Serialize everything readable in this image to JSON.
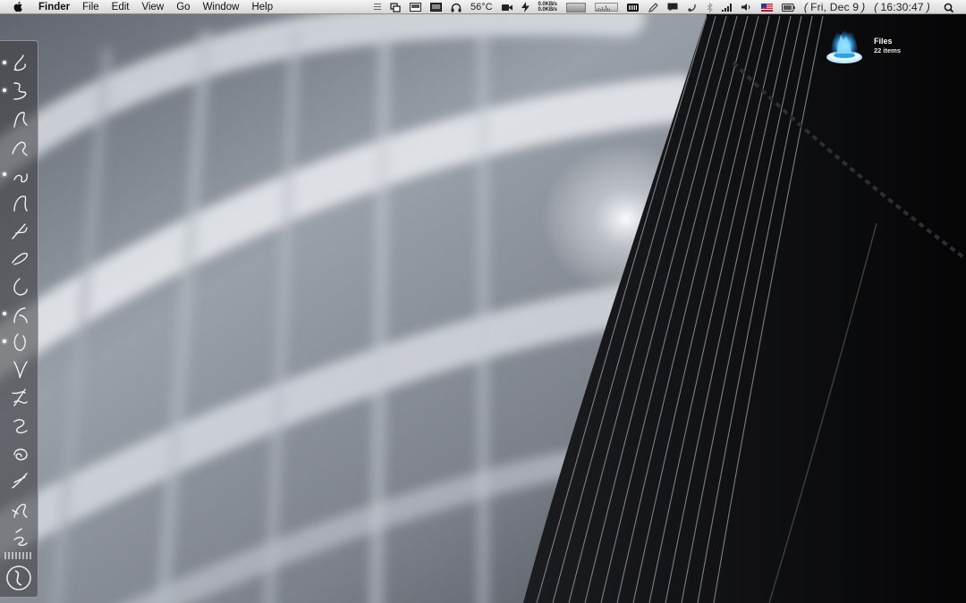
{
  "menubar": {
    "apple_icon": "apple-logo-icon",
    "menus": [
      "Finder",
      "File",
      "Edit",
      "View",
      "Go",
      "Window",
      "Help"
    ],
    "status": {
      "temperature": "56°C",
      "net_up": "0.0KB/s",
      "net_down": "0.0KB/s",
      "date": "Fri, Dec 9",
      "time": "16:30:47"
    }
  },
  "desktop": {
    "icons": [
      {
        "name": "Files",
        "subtitle": "22 items",
        "icon": "blue-flame-folder-icon"
      }
    ]
  },
  "dock": {
    "items": [
      {
        "icon": "glyph-app-1-icon",
        "running": true
      },
      {
        "icon": "glyph-app-2-icon",
        "running": true
      },
      {
        "icon": "glyph-app-3-icon",
        "running": false
      },
      {
        "icon": "glyph-app-4-icon",
        "running": false
      },
      {
        "icon": "glyph-app-5-icon",
        "running": true
      },
      {
        "icon": "glyph-app-6-icon",
        "running": false
      },
      {
        "icon": "glyph-app-7-icon",
        "running": false
      },
      {
        "icon": "glyph-app-8-icon",
        "running": false
      },
      {
        "icon": "glyph-app-9-icon",
        "running": false
      },
      {
        "icon": "glyph-app-10-icon",
        "running": true
      },
      {
        "icon": "glyph-app-11-icon",
        "running": true
      },
      {
        "icon": "glyph-app-12-icon",
        "running": false
      },
      {
        "icon": "glyph-app-13-icon",
        "running": false
      },
      {
        "icon": "glyph-app-14-icon",
        "running": false
      },
      {
        "icon": "glyph-app-15-icon",
        "running": false
      },
      {
        "icon": "glyph-app-16-icon",
        "running": false
      },
      {
        "icon": "glyph-app-17-icon",
        "running": false
      },
      {
        "icon": "glyph-app-18-icon",
        "running": false
      }
    ],
    "trash_icon": "round-trash-icon"
  },
  "colors": {
    "menubar": "#e6e6e6",
    "desktop_icon_glow": "#3fb8ff"
  }
}
